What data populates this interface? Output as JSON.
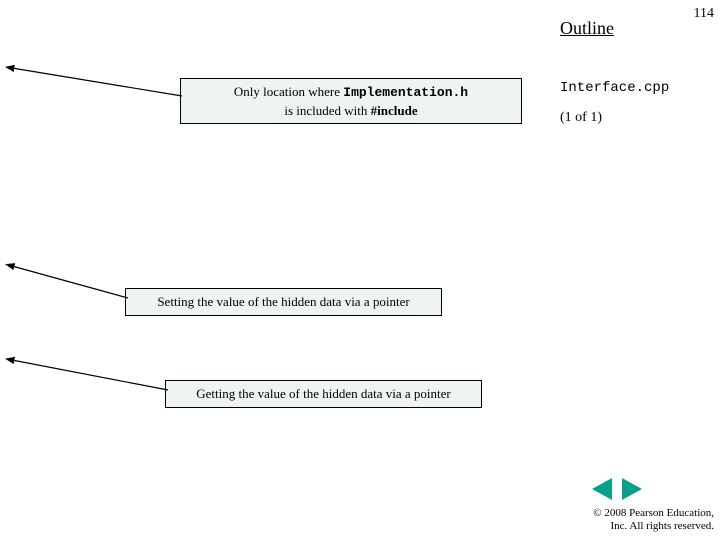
{
  "page_number": "114",
  "outline_heading": "Outline",
  "file_name": "Interface.cpp",
  "page_of": "(1 of 1)",
  "callouts": {
    "c1_prefix": "Only location where ",
    "c1_code": "Implementation.h",
    "c1_middle": "is included with ",
    "c1_keyword": "#include",
    "c2": "Setting the value of the hidden data via a pointer",
    "c3": "Getting the value of the hidden data via a pointer"
  },
  "nav": {
    "prev_name": "previous-slide",
    "next_name": "next-slide"
  },
  "copyright_line1": "© 2008 Pearson Education,",
  "copyright_line2": "Inc.  All rights reserved."
}
